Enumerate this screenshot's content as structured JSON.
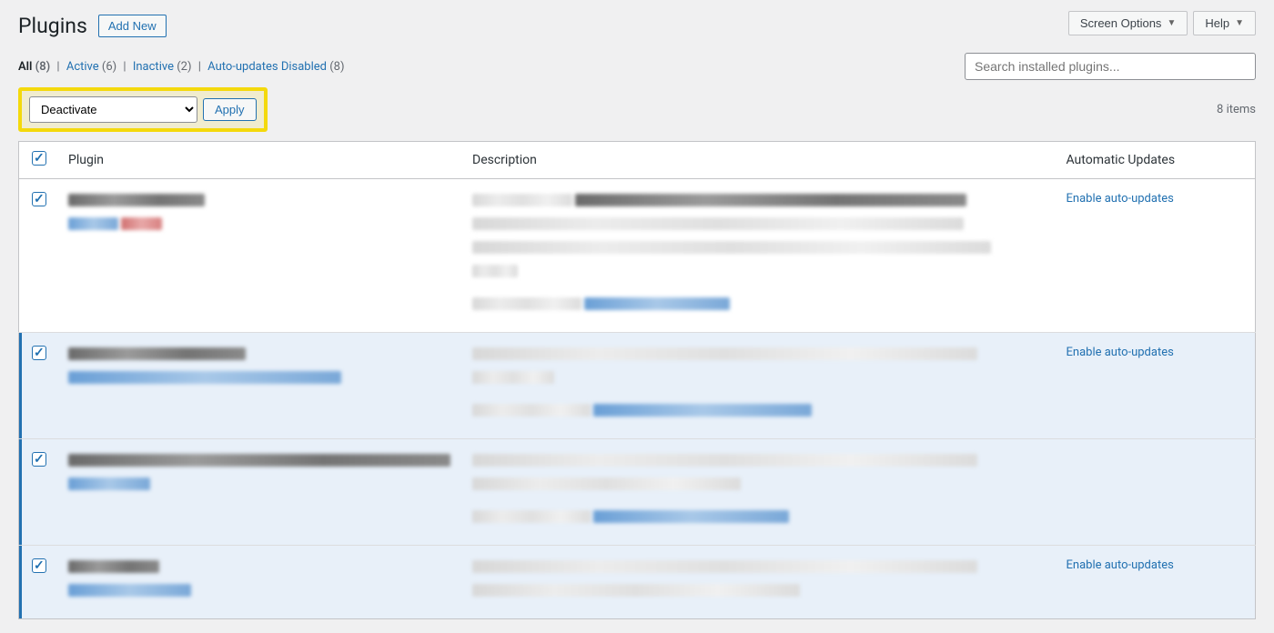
{
  "top": {
    "screen_options": "Screen Options",
    "help": "Help"
  },
  "header": {
    "title": "Plugins",
    "add_new": "Add New"
  },
  "filters": {
    "all_label": "All",
    "all_count": "(8)",
    "active_label": "Active",
    "active_count": "(6)",
    "inactive_label": "Inactive",
    "inactive_count": "(2)",
    "auto_disabled_label": "Auto-updates Disabled",
    "auto_disabled_count": "(8)"
  },
  "search": {
    "placeholder": "Search installed plugins..."
  },
  "bulk": {
    "selected": "Deactivate",
    "apply": "Apply"
  },
  "count_text": "8 items",
  "columns": {
    "plugin": "Plugin",
    "description": "Description",
    "auto": "Automatic Updates"
  },
  "auto_link": "Enable auto-updates",
  "rows": [
    {
      "active": false,
      "show_auto": true
    },
    {
      "active": true,
      "show_auto": true
    },
    {
      "active": true,
      "show_auto": false
    },
    {
      "active": true,
      "show_auto": true
    }
  ]
}
